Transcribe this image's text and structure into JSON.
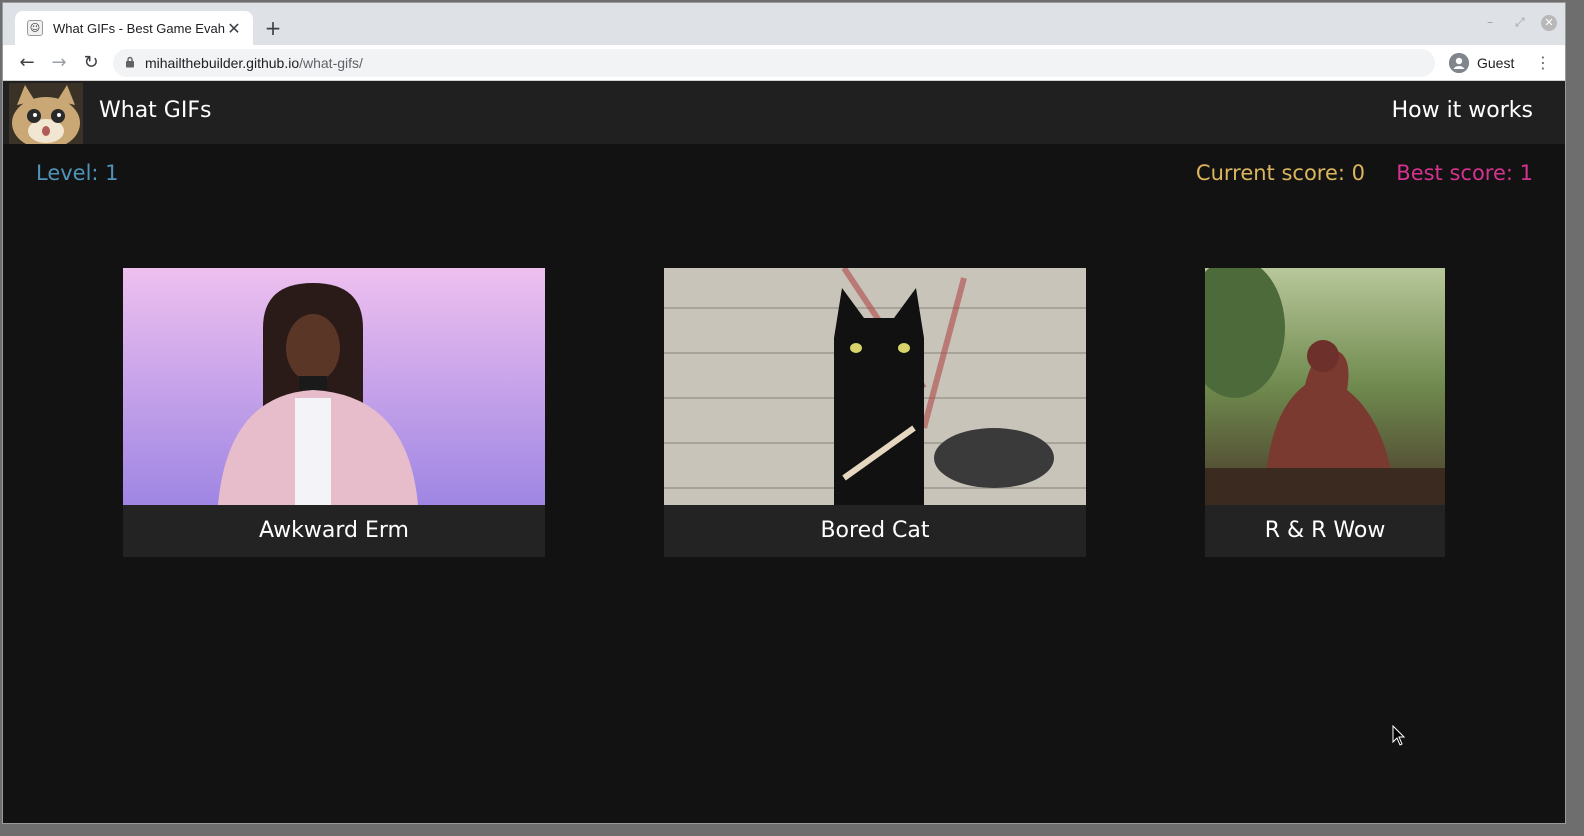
{
  "browser": {
    "tab_title": "What GIFs - Best Game Evah",
    "tab_close_glyph": "✕",
    "new_tab_glyph": "+",
    "url_host": "mihailthebuilder.github.io",
    "url_path": "/what-gifs/",
    "profile_name": "Guest",
    "icons": [
      "back-arrow-icon",
      "forward-arrow-icon",
      "reload-icon",
      "lock-icon",
      "profile-icon",
      "kebab-menu-icon"
    ]
  },
  "site": {
    "title": "What GIFs",
    "nav_link": "How it works"
  },
  "scoreboard": {
    "level": "Level: 1",
    "current_score": "Current score: 0",
    "best_score": "Best score: 1",
    "colors": {
      "level": "#4f93b8",
      "current": "#dcb65c",
      "best": "#d4338f"
    }
  },
  "cards": [
    {
      "label": "Awkward Erm"
    },
    {
      "label": "Bored Cat"
    },
    {
      "label": "R & R Wow"
    }
  ]
}
